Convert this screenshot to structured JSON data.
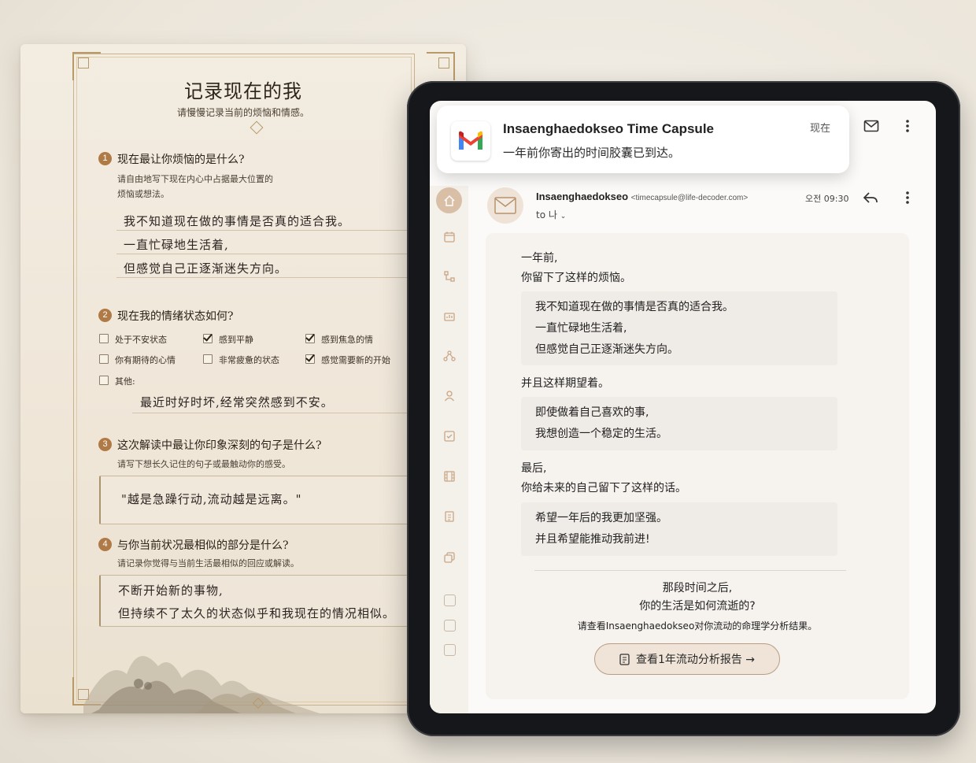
{
  "form": {
    "title": "记录现在的我",
    "subtitle": "请慢慢记录当前的烦恼和情感。",
    "q1": {
      "num": "1",
      "question": "现在最让你烦恼的是什么?",
      "hint_line1": "请自由地写下现在内心中占据最大位置的",
      "hint_line2": "烦恼或想法。",
      "answers": [
        "我不知道现在做的事情是否真的适合我。",
        "一直忙碌地生活着,",
        "但感觉自己正逐渐迷失方向。"
      ]
    },
    "q2": {
      "num": "2",
      "question": "现在我的情绪状态如何?",
      "options": [
        {
          "label": "处于不安状态",
          "checked": false
        },
        {
          "label": "感到平静",
          "checked": true
        },
        {
          "label": "感到焦急的情",
          "checked": true
        },
        {
          "label": "你有期待的心情",
          "checked": false
        },
        {
          "label": "非常疲惫的状态",
          "checked": false
        },
        {
          "label": "感觉需要新的开始",
          "checked": true
        }
      ],
      "other_label": "其他:",
      "other_answer": "最近时好时坏,经常突然感到不安。"
    },
    "q3": {
      "num": "3",
      "question": "这次解读中最让你印象深刻的句子是什么?",
      "hint": "请写下想长久记住的句子或最触动你的感受。",
      "answer": "\"越是急躁行动,流动越是远离。\""
    },
    "q4": {
      "num": "4",
      "question": "与你当前状况最相似的部分是什么?",
      "hint": "请记录你觉得与当前生活最相似的回应或解读。",
      "answers": [
        "不断开始新的事物,",
        "但持续不了太久的状态似乎和我现在的情况相似。"
      ]
    }
  },
  "notification": {
    "app_icon": "gmail-icon",
    "title": "Insaenghaedokseo Time Capsule",
    "body": "一年前你寄出的时间胶囊已到达。",
    "time": "现在"
  },
  "mail": {
    "sender_name": "Insaenghaedokseo",
    "sender_email": "<timecapsule@life-decoder.com>",
    "to": "to 나",
    "time": "오전 09:30",
    "intro_line1": "一年前,",
    "intro_line2": "你留下了这样的烦恼。",
    "quote1": [
      "我不知道现在做的事情是否真的适合我。",
      "一直忙碌地生活着,",
      "但感觉自己正逐渐迷失方向。"
    ],
    "mid_line": "并且这样期望着。",
    "quote2": [
      "即使做着自己喜欢的事,",
      "我想创造一个稳定的生活。"
    ],
    "last_line1": "最后,",
    "last_line2": "你给未来的自己留下了这样的话。",
    "quote3": [
      "希望一年后的我更加坚强。",
      "并且希望能推动我前进!"
    ],
    "closing_line1": "那段时间之后,",
    "closing_line2": "你的生活是如何流逝的?",
    "closing_line3": "请查看Insaenghaedokseo对你流动的命理学分析结果。",
    "button_label": "查看1年流动分析报告 →"
  },
  "colors": {
    "accent": "#b07a46",
    "rail_active": "#d9bfa6",
    "paper": "#efe6d8"
  }
}
